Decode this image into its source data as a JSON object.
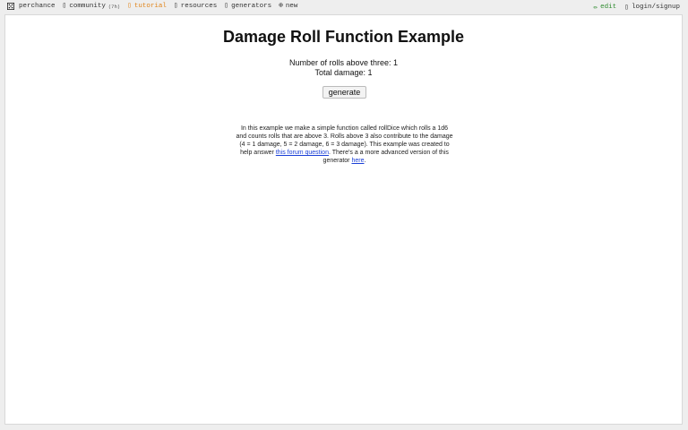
{
  "nav": {
    "brand": "perchance",
    "community": "community",
    "community_count": "(7h)",
    "tutorial": "tutorial",
    "resources": "resources",
    "generators": "generators",
    "new": "new",
    "edit": "edit",
    "login": "login/signup"
  },
  "main": {
    "title": "Damage Roll Function Example",
    "rolls_line": "Number of rolls above three: 1",
    "damage_line": "Total damage: 1",
    "generate_label": "generate",
    "desc_part1": "In this example we make a simple function called rollDice which rolls a 1d6 and counts rolls that are above 3. Rolls above 3 also contribute to the damage (4 = 1 damage, 5 = 2 damage, 6 = 3 damage). This example was created to help answer ",
    "desc_link1": "this forum question",
    "desc_part2": ". There's a a more advanced version of this generator ",
    "desc_link2": "here",
    "desc_part3": "."
  },
  "colors": {
    "active_nav": "#e0841a",
    "edit": "#2e8b2e",
    "link": "#1a3fd6"
  }
}
